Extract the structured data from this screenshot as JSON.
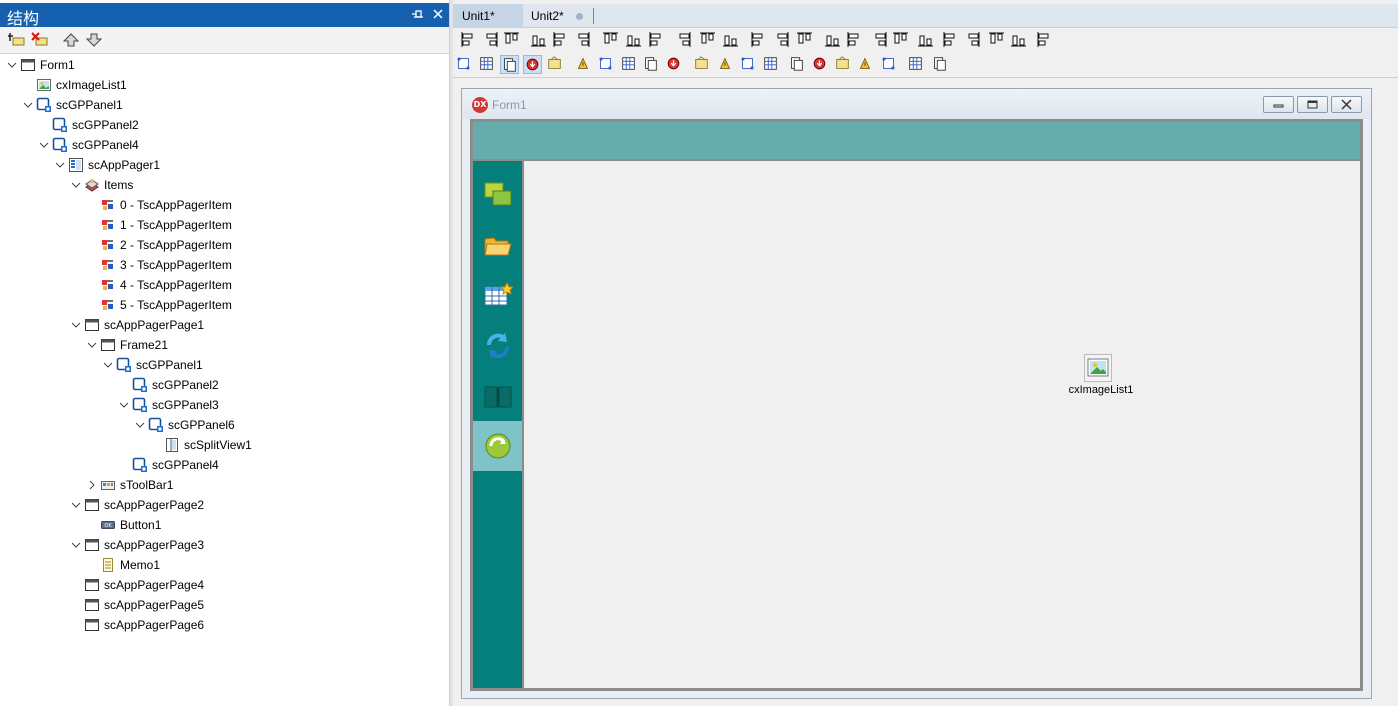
{
  "structure": {
    "title": "结构",
    "tree": [
      {
        "label": "Form1",
        "icon": "form-icon",
        "depth": 0,
        "expander": "expanded"
      },
      {
        "label": "cxImageList1",
        "icon": "image-list-icon",
        "depth": 1,
        "expander": "none"
      },
      {
        "label": "scGPPanel1",
        "icon": "panel-icon",
        "depth": 1,
        "expander": "expanded"
      },
      {
        "label": "scGPPanel2",
        "icon": "panel-icon",
        "depth": 2,
        "expander": "none"
      },
      {
        "label": "scGPPanel4",
        "icon": "panel-icon",
        "depth": 2,
        "expander": "expanded"
      },
      {
        "label": "scAppPager1",
        "icon": "app-pager-icon",
        "depth": 3,
        "expander": "expanded"
      },
      {
        "label": "Items",
        "icon": "collection-icon",
        "depth": 4,
        "expander": "expanded"
      },
      {
        "label": "0 - TscAppPagerItem",
        "icon": "item-icon",
        "depth": 5,
        "expander": "none"
      },
      {
        "label": "1 - TscAppPagerItem",
        "icon": "item-icon",
        "depth": 5,
        "expander": "none"
      },
      {
        "label": "2 - TscAppPagerItem",
        "icon": "item-icon",
        "depth": 5,
        "expander": "none"
      },
      {
        "label": "3 - TscAppPagerItem",
        "icon": "item-icon",
        "depth": 5,
        "expander": "none"
      },
      {
        "label": "4 - TscAppPagerItem",
        "icon": "item-icon",
        "depth": 5,
        "expander": "none"
      },
      {
        "label": "5 - TscAppPagerItem",
        "icon": "item-icon",
        "depth": 5,
        "expander": "none"
      },
      {
        "label": "scAppPagerPage1",
        "icon": "form-icon",
        "depth": 4,
        "expander": "expanded"
      },
      {
        "label": "Frame21",
        "icon": "form-icon",
        "depth": 5,
        "expander": "expanded"
      },
      {
        "label": "scGPPanel1",
        "icon": "panel-icon",
        "depth": 6,
        "expander": "expanded"
      },
      {
        "label": "scGPPanel2",
        "icon": "panel-icon",
        "depth": 7,
        "expander": "none"
      },
      {
        "label": "scGPPanel3",
        "icon": "panel-icon",
        "depth": 7,
        "expander": "expanded"
      },
      {
        "label": "scGPPanel6",
        "icon": "panel-icon",
        "depth": 8,
        "expander": "expanded"
      },
      {
        "label": "scSplitView1",
        "icon": "split-view-icon",
        "depth": 9,
        "expander": "none"
      },
      {
        "label": "scGPPanel4",
        "icon": "panel-icon",
        "depth": 7,
        "expander": "none"
      },
      {
        "label": "sToolBar1",
        "icon": "toolbar-icon",
        "depth": 5,
        "expander": "collapsed"
      },
      {
        "label": "scAppPagerPage2",
        "icon": "form-icon",
        "depth": 4,
        "expander": "expanded"
      },
      {
        "label": "Button1",
        "icon": "button-ok-icon",
        "depth": 5,
        "expander": "none"
      },
      {
        "label": "scAppPagerPage3",
        "icon": "form-icon",
        "depth": 4,
        "expander": "expanded"
      },
      {
        "label": "Memo1",
        "icon": "memo-icon",
        "depth": 5,
        "expander": "none"
      },
      {
        "label": "scAppPagerPage4",
        "icon": "form-icon",
        "depth": 4,
        "expander": "none"
      },
      {
        "label": "scAppPagerPage5",
        "icon": "form-icon",
        "depth": 4,
        "expander": "none"
      },
      {
        "label": "scAppPagerPage6",
        "icon": "form-icon",
        "depth": 4,
        "expander": "none"
      }
    ]
  },
  "tabs": [
    {
      "label": "Unit1*",
      "active": true
    },
    {
      "label": "Unit2*",
      "active": false
    }
  ],
  "form": {
    "title": "Form1",
    "logo": "DX",
    "component_label": "cxImageList1",
    "pager_buttons": [
      "windows-icon",
      "folder-open-icon",
      "table-new-icon",
      "refresh-icon",
      "book-icon",
      "green-refresh-icon"
    ],
    "selected_pager_index": 5
  },
  "colors": {
    "title_bar": "#1660b0",
    "pager_top": "#67acad",
    "pager_side": "#047f7c",
    "pager_selected": "#7fc3c9"
  }
}
